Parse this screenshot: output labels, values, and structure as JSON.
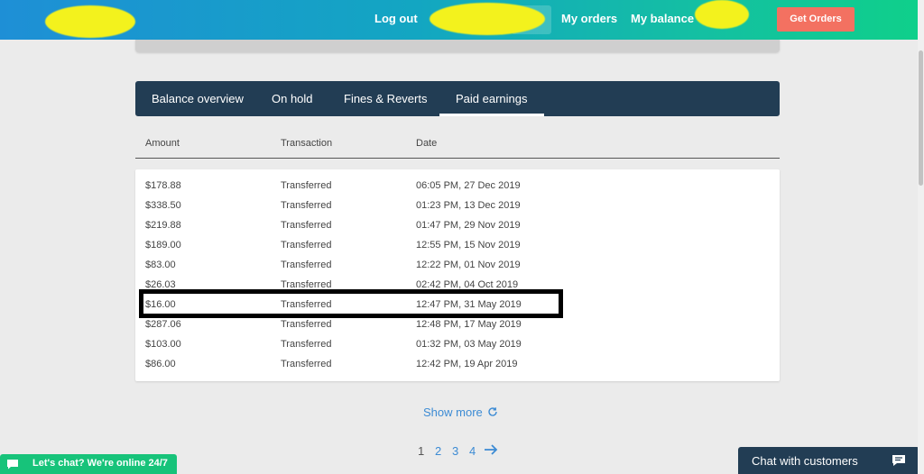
{
  "header": {
    "logout_label": "Log out",
    "my_orders_label": "My orders",
    "my_balance_label": "My balance",
    "get_orders_label": "Get Orders"
  },
  "tabs": [
    {
      "label": "Balance overview",
      "active": false
    },
    {
      "label": "On hold",
      "active": false
    },
    {
      "label": "Fines & Reverts",
      "active": false
    },
    {
      "label": "Paid earnings",
      "active": true
    }
  ],
  "table": {
    "columns": [
      "Amount",
      "Transaction",
      "Date"
    ],
    "rows": [
      {
        "amount": "$178.88",
        "transaction": "Transferred",
        "date": "06:05 PM, 27 Dec 2019"
      },
      {
        "amount": "$338.50",
        "transaction": "Transferred",
        "date": "01:23 PM, 13 Dec 2019"
      },
      {
        "amount": "$219.88",
        "transaction": "Transferred",
        "date": "01:47 PM, 29 Nov 2019"
      },
      {
        "amount": "$189.00",
        "transaction": "Transferred",
        "date": "12:55 PM, 15 Nov 2019"
      },
      {
        "amount": "$83.00",
        "transaction": "Transferred",
        "date": "12:22 PM, 01 Nov 2019"
      },
      {
        "amount": "$26.03",
        "transaction": "Transferred",
        "date": "02:42 PM, 04 Oct 2019"
      },
      {
        "amount": "$16.00",
        "transaction": "Transferred",
        "date": "12:47 PM, 31 May 2019"
      },
      {
        "amount": "$287.06",
        "transaction": "Transferred",
        "date": "12:48 PM, 17 May 2019"
      },
      {
        "amount": "$103.00",
        "transaction": "Transferred",
        "date": "01:32 PM, 03 May 2019"
      },
      {
        "amount": "$86.00",
        "transaction": "Transferred",
        "date": "12:42 PM, 19 Apr 2019"
      }
    ]
  },
  "show_more_label": "Show more",
  "pagination": {
    "pages": [
      "1",
      "2",
      "3",
      "4"
    ],
    "current": "1"
  },
  "chat": {
    "left_label": "Let's chat? We're online 24/7",
    "right_label": "Chat with customers"
  },
  "colors": {
    "tab_bar": "#223d54",
    "get_orders": "#f37161",
    "link": "#3c8bd4",
    "chat_green": "#17c37a"
  }
}
